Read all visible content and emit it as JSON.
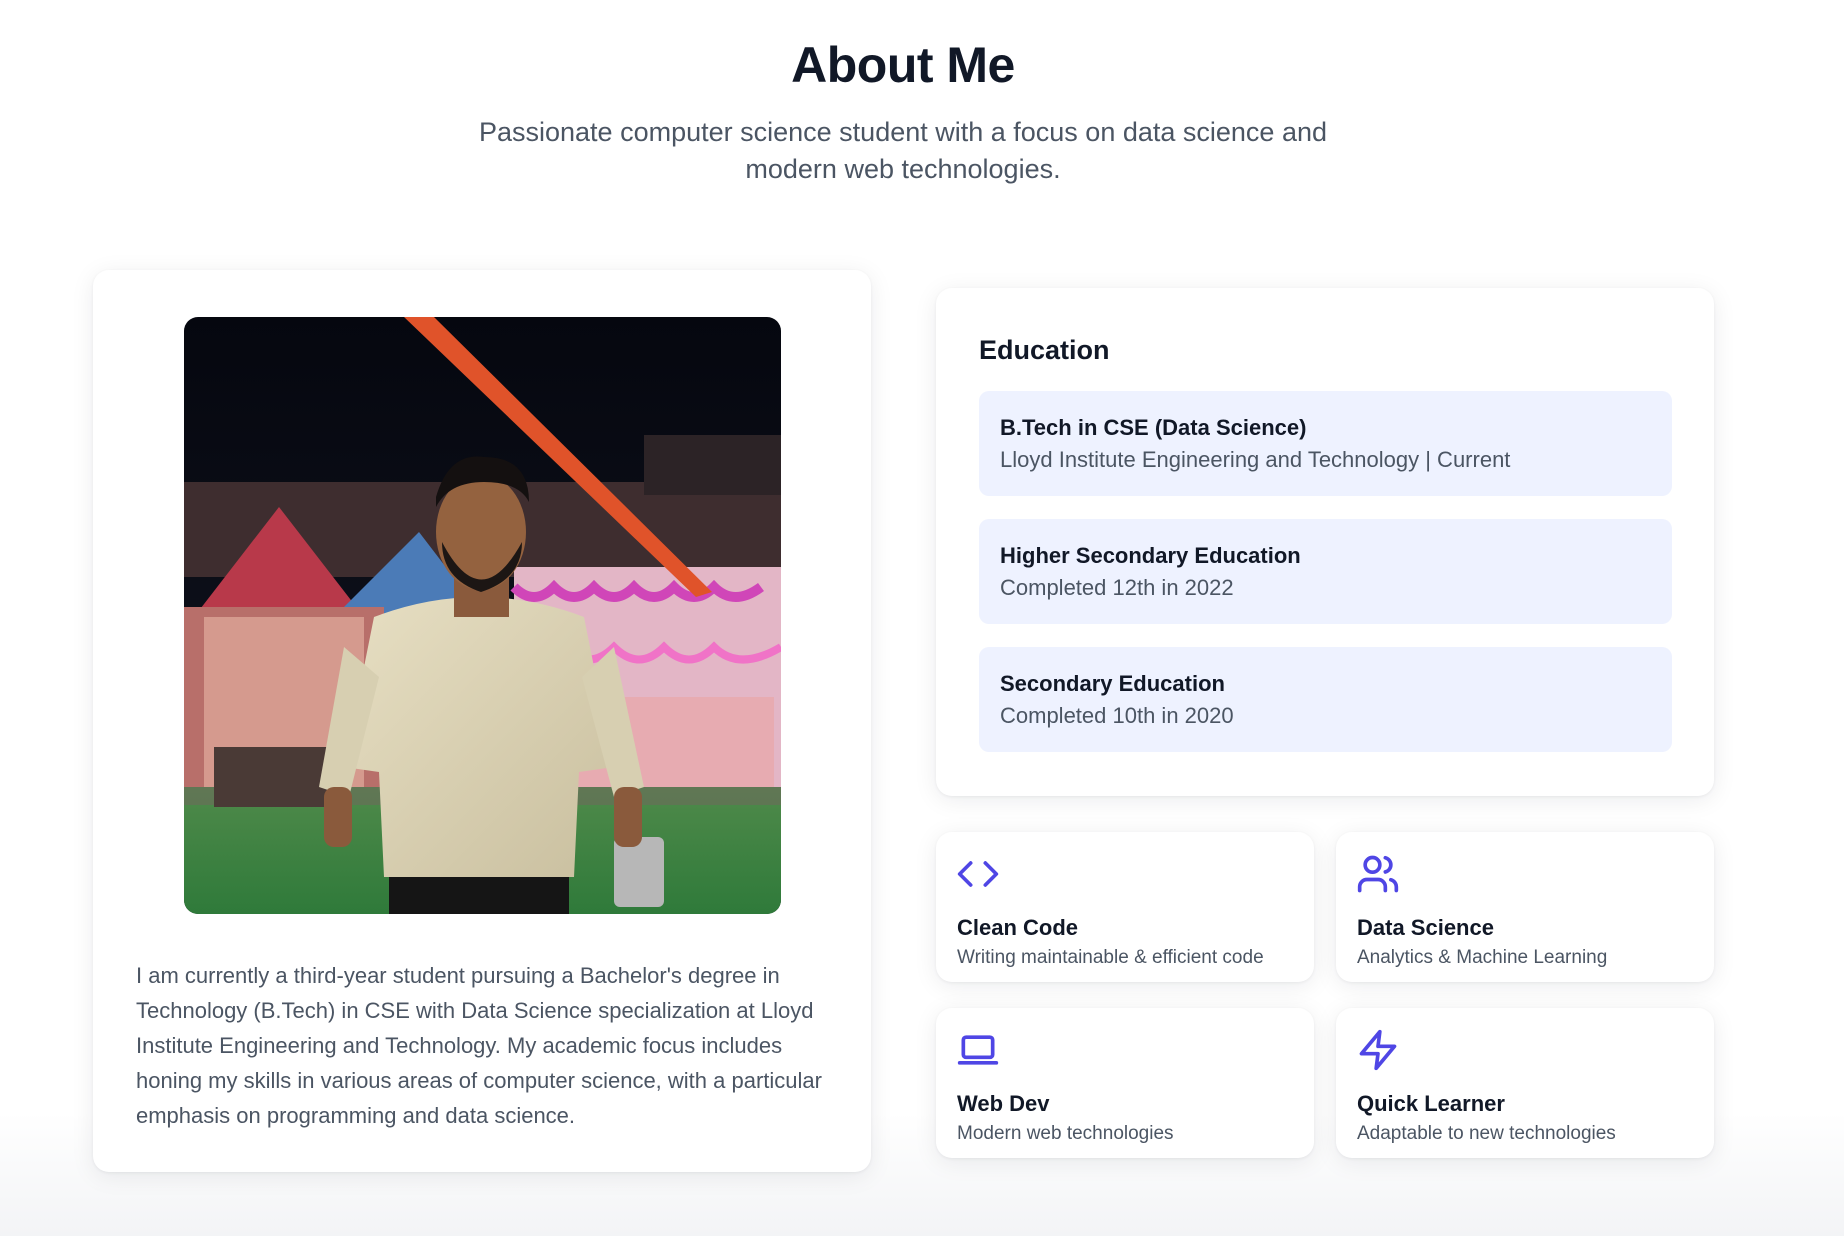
{
  "header": {
    "title": "About Me",
    "subtitle_line1": "Passionate computer science student with a focus on data science and",
    "subtitle_line2": "modern web technologies."
  },
  "profile": {
    "bio": "I am currently a third-year student pursuing a Bachelor's degree in Technology (B.Tech) in CSE with Data Science specialization at Lloyd Institute Engineering and Technology. My academic focus includes honing my skills in various areas of computer science, with a particular emphasis on programming and data science."
  },
  "education": {
    "heading": "Education",
    "items": [
      {
        "degree": "B.Tech in CSE (Data Science)",
        "detail": "Lloyd Institute Engineering and Technology | Current"
      },
      {
        "degree": "Higher Secondary Education",
        "detail": "Completed 12th in 2022"
      },
      {
        "degree": "Secondary Education",
        "detail": "Completed 10th in 2020"
      }
    ]
  },
  "features": [
    {
      "title": "Clean Code",
      "desc": "Writing maintainable & efficient code",
      "icon": "code-icon"
    },
    {
      "title": "Data Science",
      "desc": "Analytics & Machine Learning",
      "icon": "users-icon"
    },
    {
      "title": "Web Dev",
      "desc": "Modern web technologies",
      "icon": "laptop-icon"
    },
    {
      "title": "Quick Learner",
      "desc": "Adaptable to new technologies",
      "icon": "lightning-icon"
    }
  ],
  "colors": {
    "accent": "#4f46e5",
    "edu_item_bg": "#eef2ff",
    "heading": "#111827",
    "body_text": "#4b5563"
  }
}
